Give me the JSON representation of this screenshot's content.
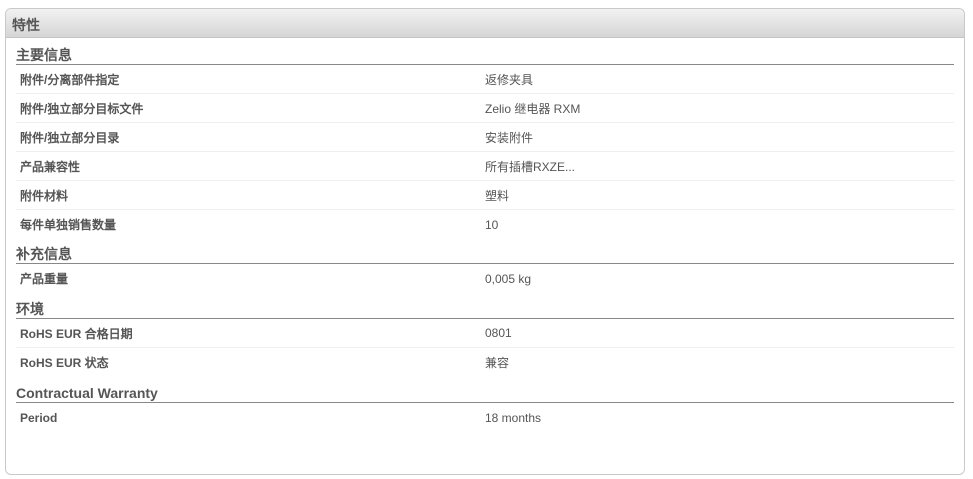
{
  "panel": {
    "title": "特性"
  },
  "sections": [
    {
      "title": "主要信息",
      "rows": [
        {
          "label": "附件/分离部件指定",
          "value": "返修夹具"
        },
        {
          "label": "附件/独立部分目标文件",
          "value": "Zelio 继电器 RXM"
        },
        {
          "label": "附件/独立部分目录",
          "value": "安装附件"
        },
        {
          "label": "产品兼容性",
          "value": "所有插槽RXZE..."
        },
        {
          "label": "附件材料",
          "value": "塑料"
        },
        {
          "label": "每件单独销售数量",
          "value": "10"
        }
      ]
    },
    {
      "title": "补充信息",
      "rows": [
        {
          "label": "产品重量",
          "value": "0,005 kg"
        }
      ]
    },
    {
      "title": "环境",
      "rows": [
        {
          "label": "RoHS EUR 合格日期",
          "value": "0801"
        },
        {
          "label": "RoHS EUR 状态",
          "value": "兼容"
        }
      ]
    },
    {
      "title": "Contractual Warranty",
      "rows": [
        {
          "label": "Period",
          "value": "18 months"
        }
      ]
    }
  ]
}
